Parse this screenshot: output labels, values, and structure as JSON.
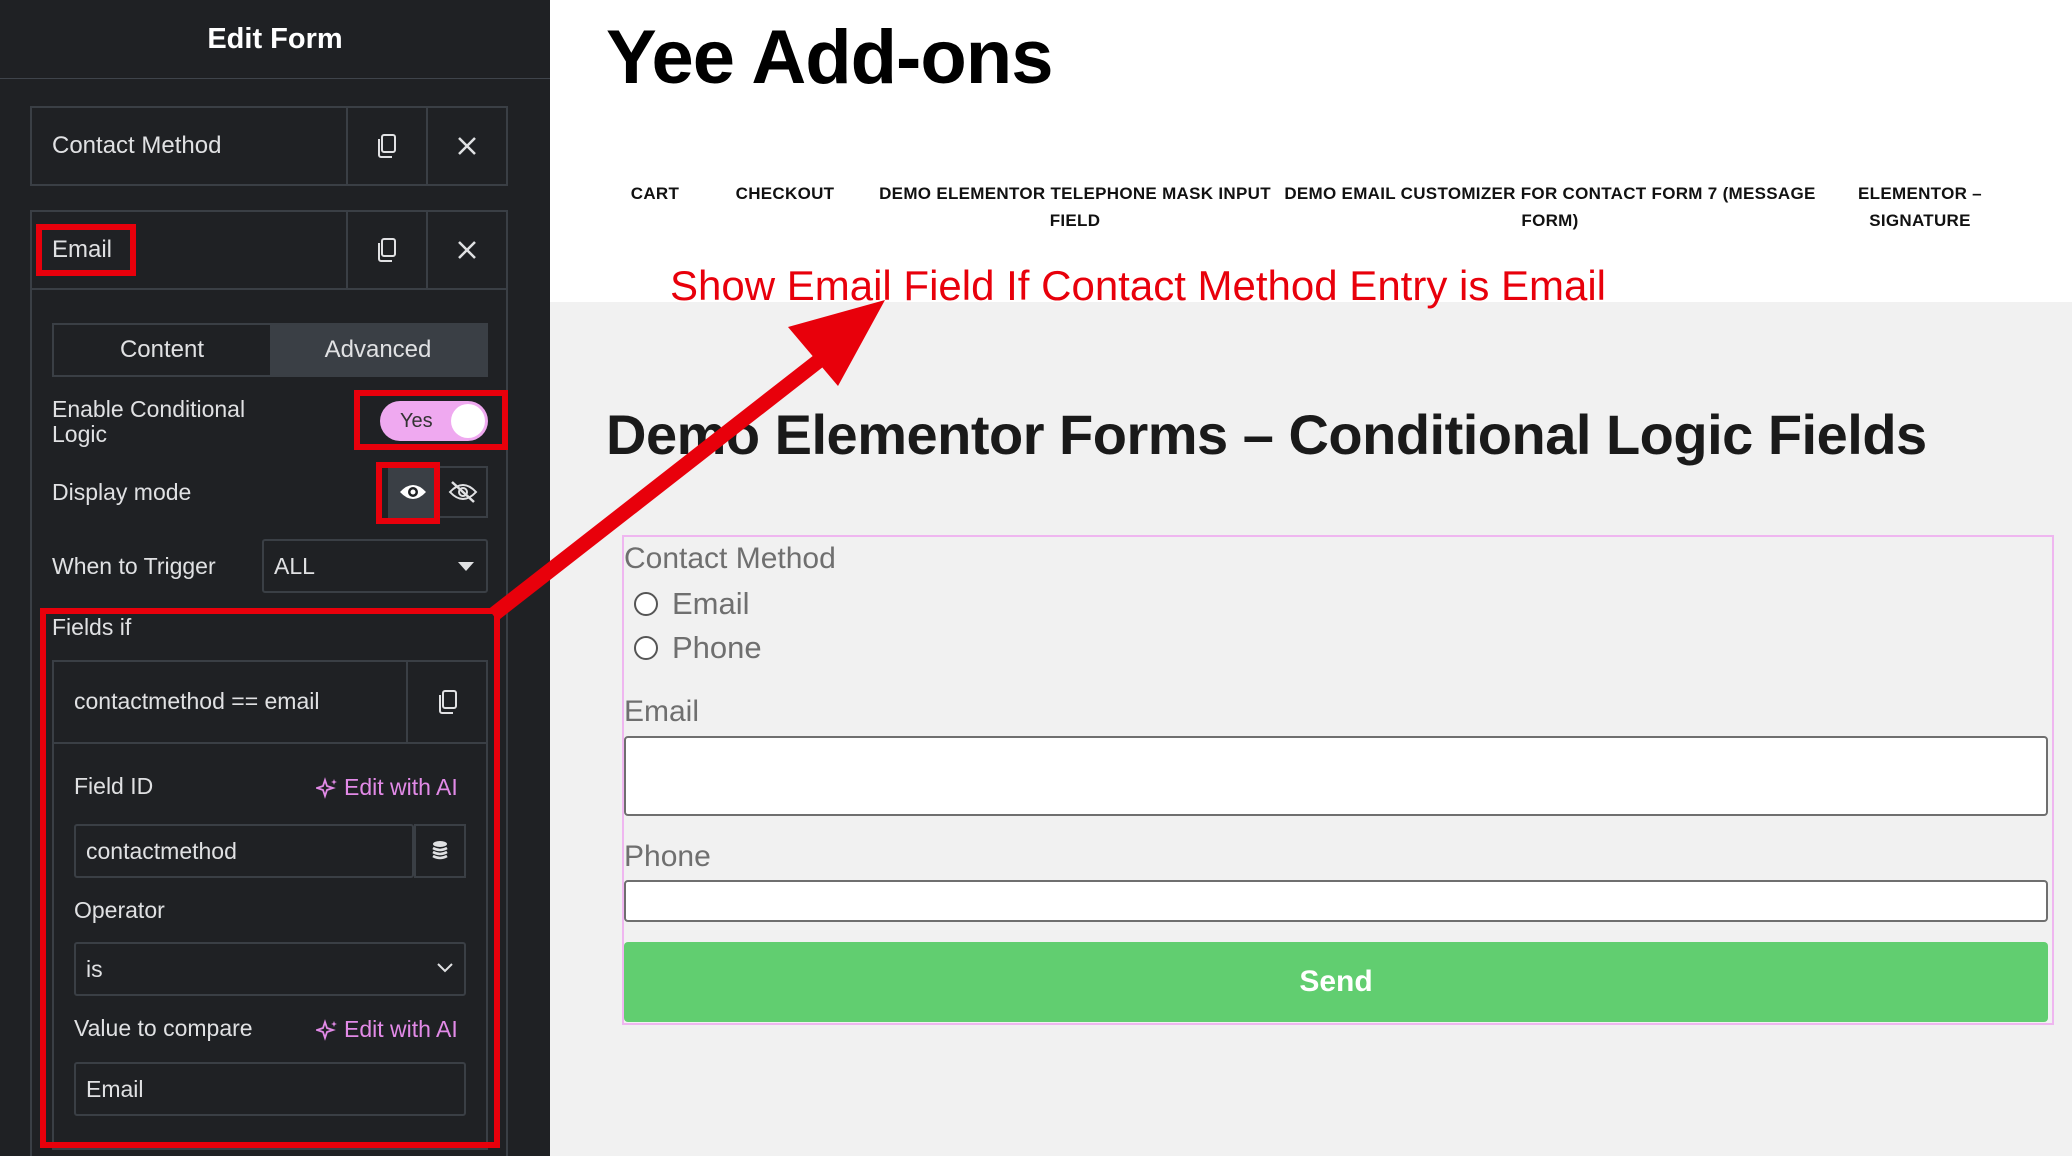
{
  "panel": {
    "title": "Edit Form",
    "repeater_items": [
      {
        "label": "Contact Method"
      },
      {
        "label": "Email"
      }
    ],
    "tabs": [
      {
        "label": "Content",
        "active": false
      },
      {
        "label": "Advanced",
        "active": true
      }
    ],
    "enable_conditional_logic": {
      "label": "Enable Conditional Logic",
      "value": "Yes"
    },
    "display_mode": {
      "label": "Display mode",
      "options": [
        "show-icon",
        "hide-icon"
      ],
      "selected": "show-icon"
    },
    "when_to_trigger": {
      "label": "When to Trigger",
      "value": "ALL"
    },
    "fields_if": {
      "label": "Fields if",
      "rule_title": "contactmethod == email",
      "field_id": {
        "label": "Field ID",
        "value": "contactmethod",
        "ai_label": "Edit with AI"
      },
      "operator": {
        "label": "Operator",
        "value": "is"
      },
      "value_to_compare": {
        "label": "Value to compare",
        "value": "Email",
        "ai_label": "Edit with AI"
      }
    }
  },
  "page": {
    "site_title": "Yee Add-ons",
    "nav": [
      {
        "label": "CART"
      },
      {
        "label": "CHECKOUT"
      },
      {
        "label": "DEMO ELEMENTOR TELEPHONE MASK INPUT FIELD"
      },
      {
        "label": "DEMO EMAIL CUSTOMIZER FOR CONTACT FORM 7 (MESSAGE FORM)"
      },
      {
        "label": "ELEMENTOR – SIGNATURE"
      }
    ],
    "annotation": "Show Email Field If Contact Method Entry is Email",
    "heading": "Demo Elementor Forms – Conditional Logic Fields",
    "form": {
      "contact_method_label": "Contact Method",
      "radio_options": [
        "Email",
        "Phone"
      ],
      "email_label": "Email",
      "email_value": "",
      "phone_label": "Phone",
      "phone_value": "",
      "submit_label": "Send"
    }
  },
  "colors": {
    "panel_bg": "#1f2124",
    "accent_pink": "#efa9f0",
    "highlight_red": "#e8000b",
    "send_green": "#61ce70"
  }
}
